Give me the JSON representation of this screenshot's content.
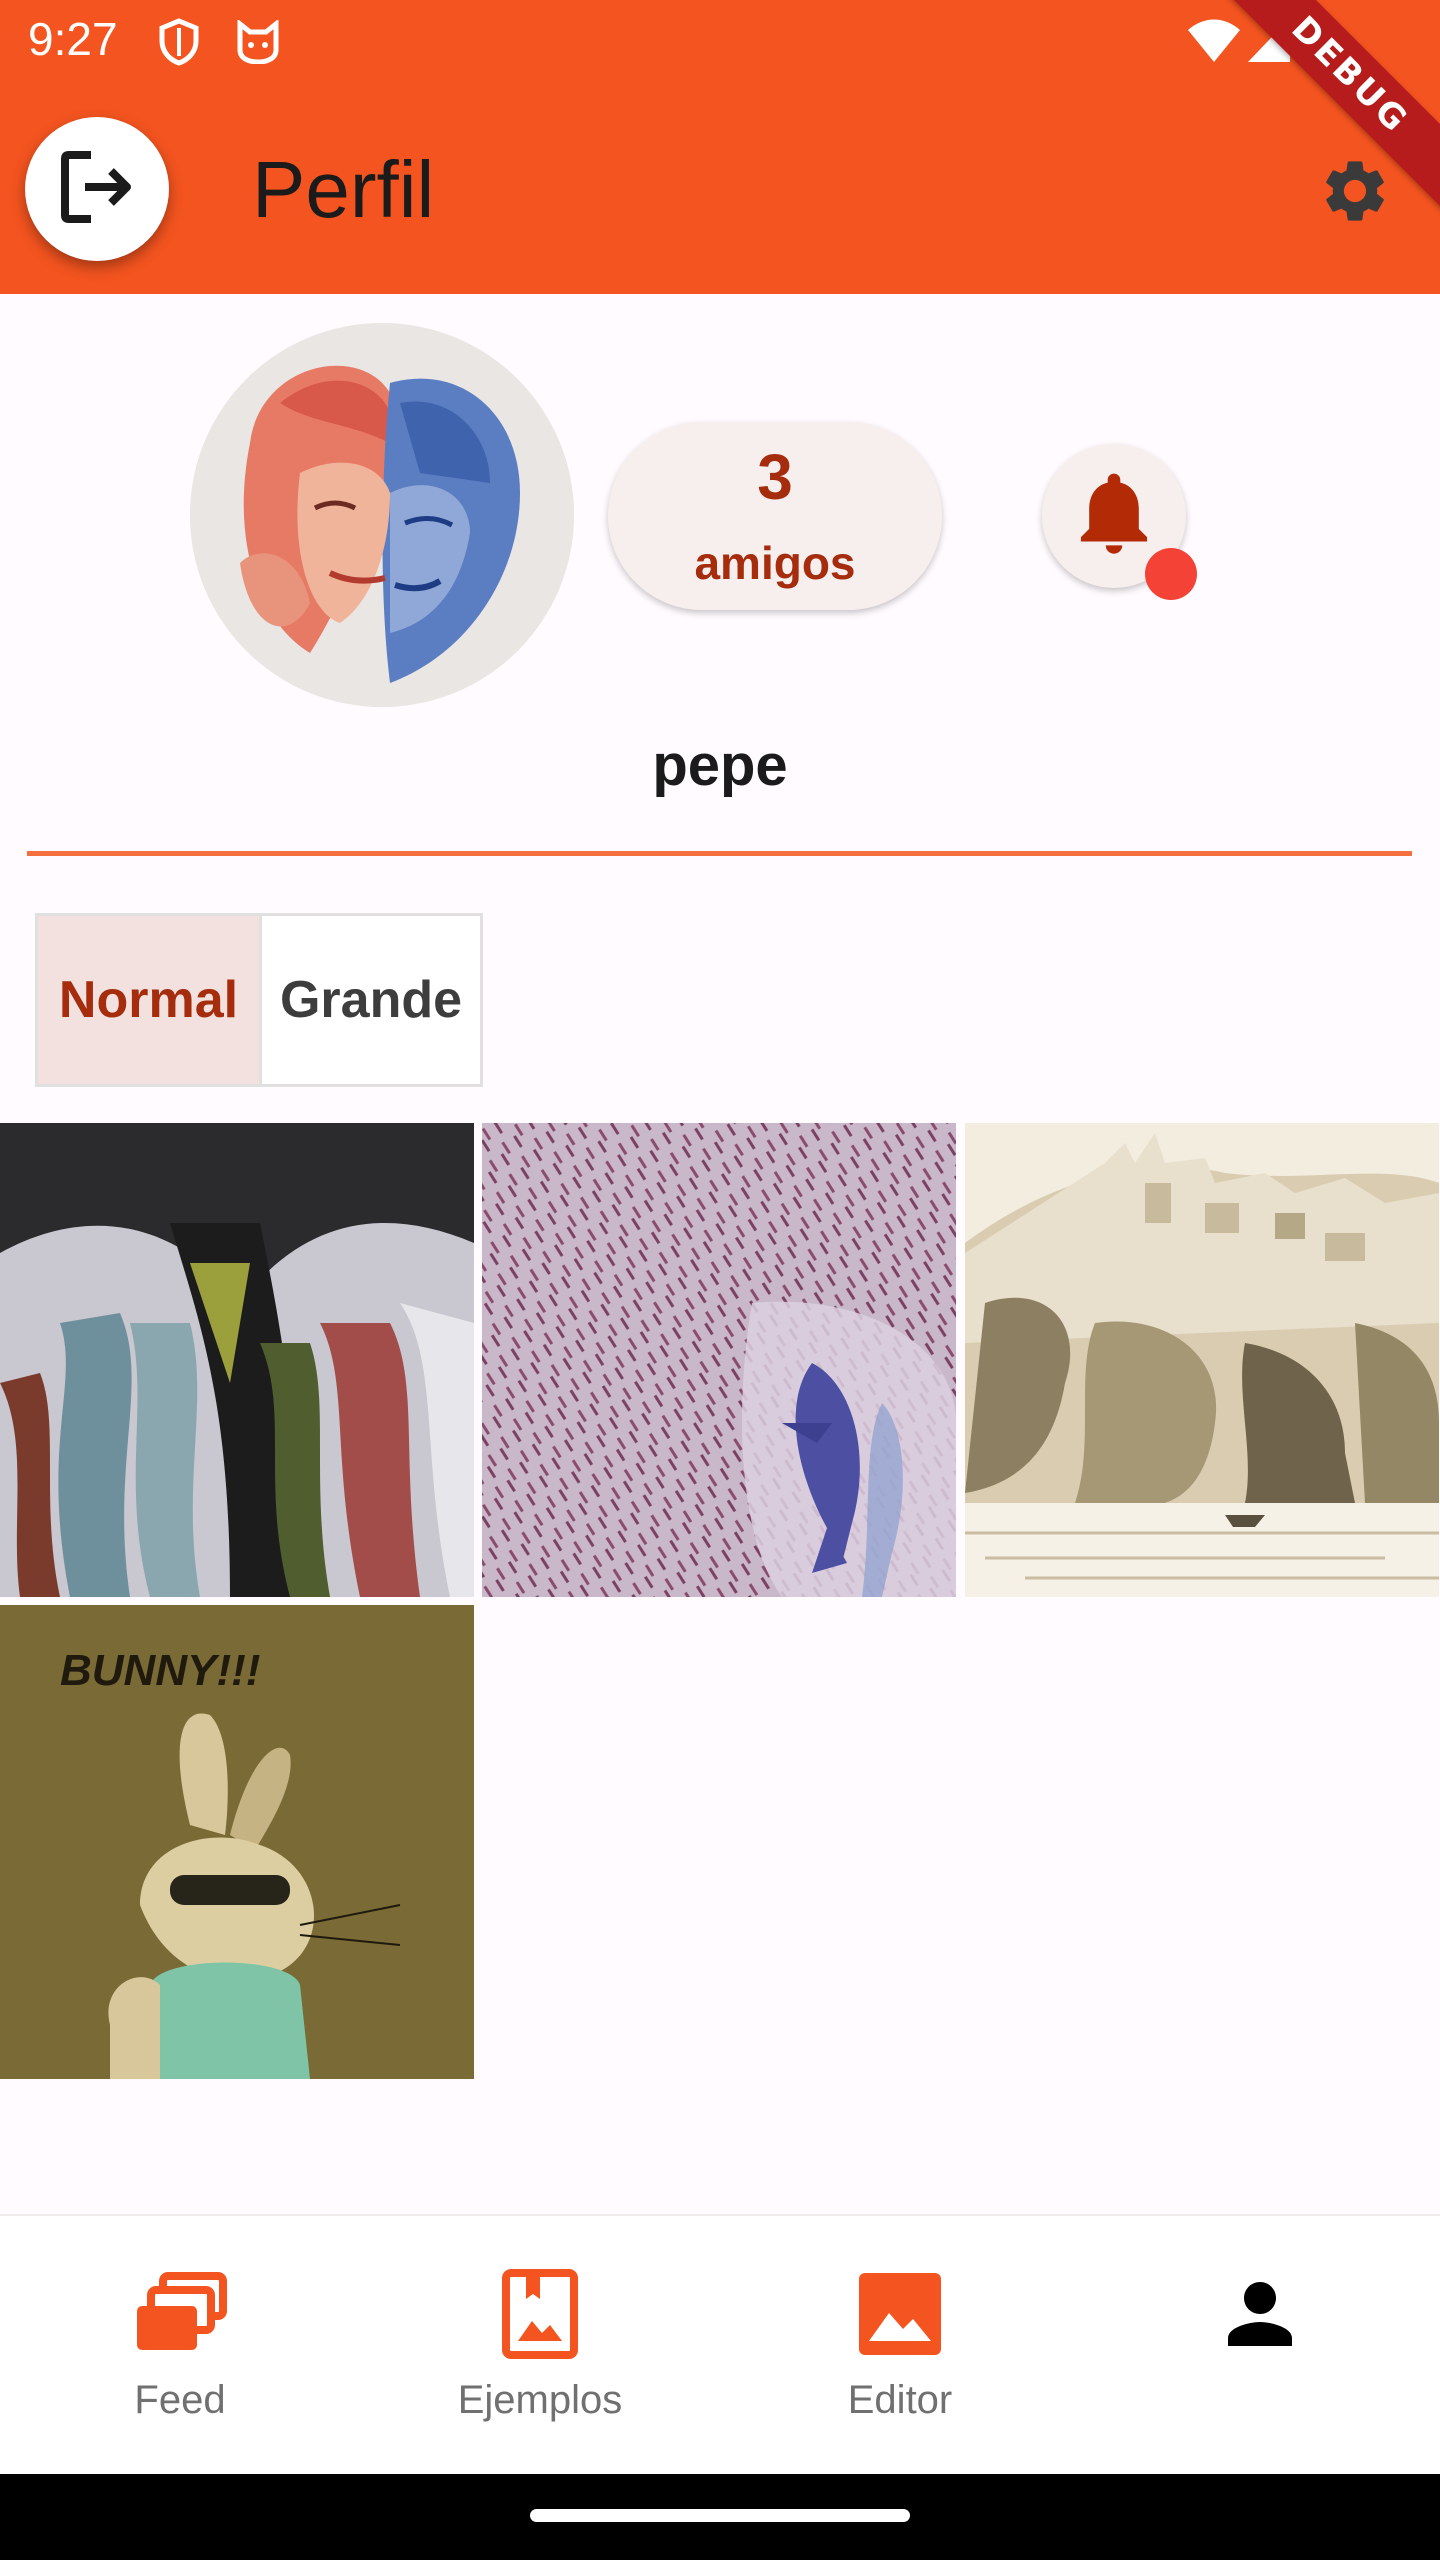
{
  "status_bar": {
    "time": "9:27",
    "icons": [
      "shield-icon",
      "cat-icon",
      "wifi-icon",
      "signal-icon",
      "battery-icon"
    ],
    "debug_banner": "DEBUG"
  },
  "app_bar": {
    "title": "Perfil",
    "background": "#f4541f",
    "logout_icon": "logout-icon",
    "settings_icon": "gear-icon"
  },
  "profile": {
    "username": "pepe",
    "friends_count": "3",
    "friends_label": "amigos",
    "has_notifications": true,
    "accent": "#a52c0c"
  },
  "view_toggle": {
    "options": [
      "Normal",
      "Grande"
    ],
    "selected": "Normal"
  },
  "gallery": {
    "items": [
      "abstract-eye-painting",
      "fish-watercolor",
      "coastal-town-sketch",
      "bunny-illustration"
    ],
    "bunny_caption": "BUNNY!!!"
  },
  "bottom_nav": {
    "items": [
      {
        "label": "Feed",
        "icon": "stack-icon"
      },
      {
        "label": "Ejemplos",
        "icon": "bookmark-image-icon"
      },
      {
        "label": "Editor",
        "icon": "image-icon"
      },
      {
        "label": "",
        "icon": "person-icon"
      }
    ],
    "active_index": 3,
    "active_color": "#f4541f"
  }
}
